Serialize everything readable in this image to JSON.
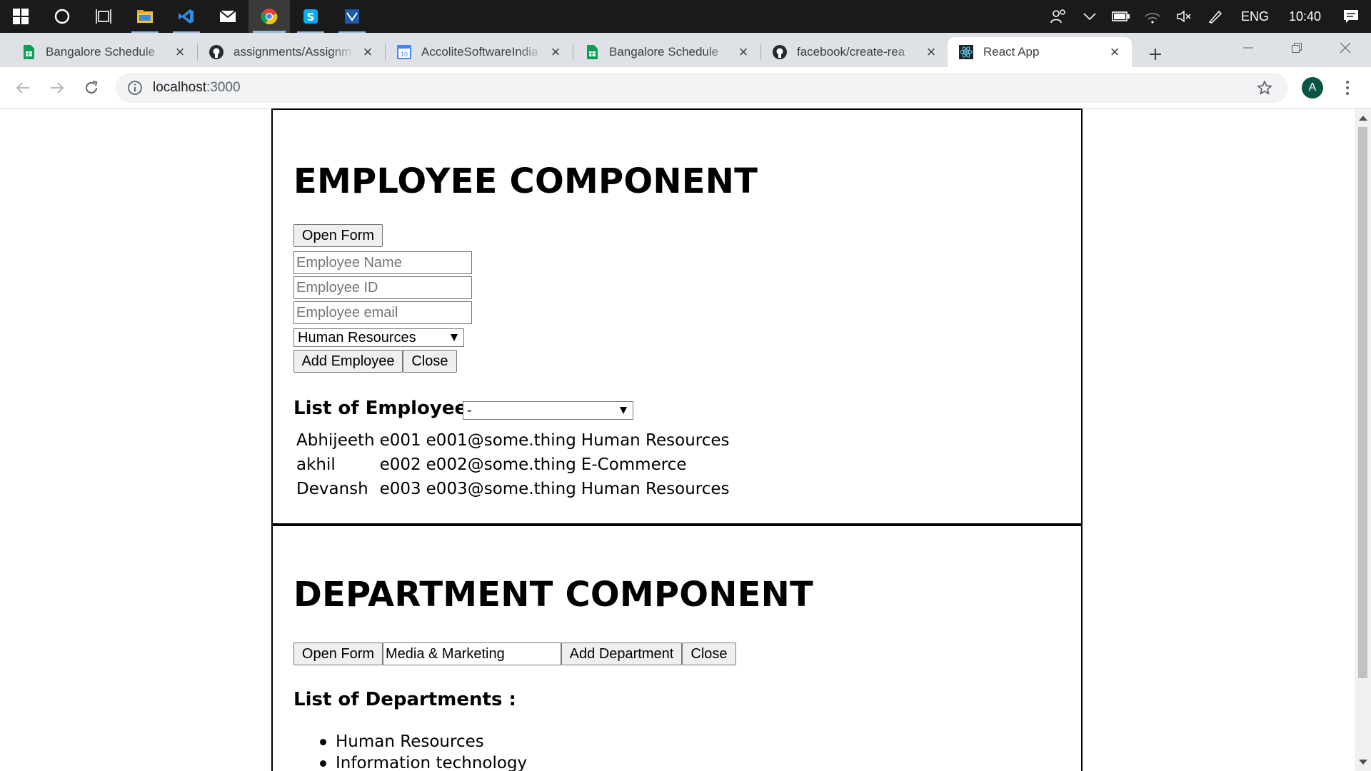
{
  "taskbar": {
    "tray": {
      "language": "ENG",
      "time": "10:40"
    }
  },
  "browser": {
    "tabs": [
      {
        "label": "Bangalore Schedule",
        "icon": "google-sheets-icon"
      },
      {
        "label": "assignments/Assignm",
        "icon": "github-icon"
      },
      {
        "label": "AccoliteSoftwareIndia",
        "icon": "google-calendar-icon"
      },
      {
        "label": "Bangalore Schedule",
        "icon": "google-sheets-icon"
      },
      {
        "label": "facebook/create-rea",
        "icon": "github-icon"
      },
      {
        "label": "React App",
        "icon": "react-icon",
        "active": true
      }
    ],
    "url_host": "localhost",
    "url_port": ":3000",
    "profile_initial": "A"
  },
  "employee": {
    "heading": "EMPLOYEE COMPONENT",
    "open_form": "Open Form",
    "name_placeholder": "Employee Name",
    "id_placeholder": "Employee ID",
    "email_placeholder": "Employee email",
    "department_selected": "Human Resources",
    "add_button": "Add Employee",
    "close_button": "Close",
    "list_heading": "List of Employees:",
    "filter_selected": "-",
    "rows": [
      {
        "name": "Abhijeeth",
        "id": "e001",
        "email": "e001@some.thing",
        "department": "Human Resources"
      },
      {
        "name": "akhil",
        "id": "e002",
        "email": "e002@some.thing",
        "department": "E-Commerce"
      },
      {
        "name": "Devansh",
        "id": "e003",
        "email": "e003@some.thing",
        "department": "Human Resources"
      }
    ]
  },
  "department": {
    "heading": "DEPARTMENT COMPONENT",
    "open_form": "Open Form",
    "input_value": "Media & Marketing",
    "add_button": "Add Department",
    "close_button": "Close",
    "list_heading": "List of Departments :",
    "items": [
      "Human Resources",
      "Information technology"
    ]
  },
  "colors": {
    "taskbar": "#1a1a1a",
    "tabstrip": "#dee1e6",
    "omnibox": "#f1f3f4"
  }
}
